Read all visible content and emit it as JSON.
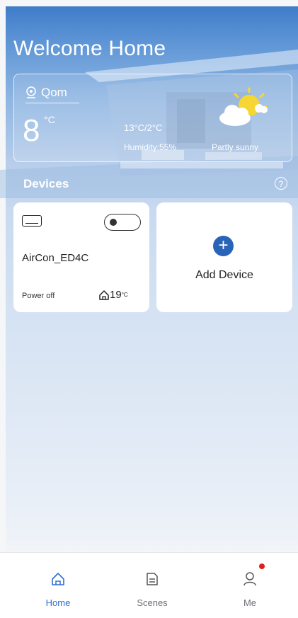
{
  "header": {
    "title": "Welcome Home"
  },
  "weather": {
    "city": "Qom",
    "temperature": "8",
    "unit": "°C",
    "range": "13°C/2°C",
    "humidity": "Humidity:55%",
    "condition": "Partly sunny",
    "icon": "partly-sunny-icon"
  },
  "devices": {
    "label": "Devices",
    "help_icon": "help-icon",
    "items": [
      {
        "name": "AirCon_ED4C",
        "status": "Power off",
        "room_temp": "19",
        "room_temp_unit": "°C",
        "icon": "aircon-icon"
      }
    ],
    "add_label": "Add Device"
  },
  "tabbar": {
    "items": [
      {
        "label": "Home",
        "icon": "home-icon",
        "active": true
      },
      {
        "label": "Scenes",
        "icon": "scenes-icon",
        "active": false
      },
      {
        "label": "Me",
        "icon": "user-icon",
        "active": false,
        "badge": true
      }
    ]
  },
  "colors": {
    "accent": "#2f6fd0",
    "badge": "#e01d1d",
    "add_button": "#2a64b8"
  }
}
